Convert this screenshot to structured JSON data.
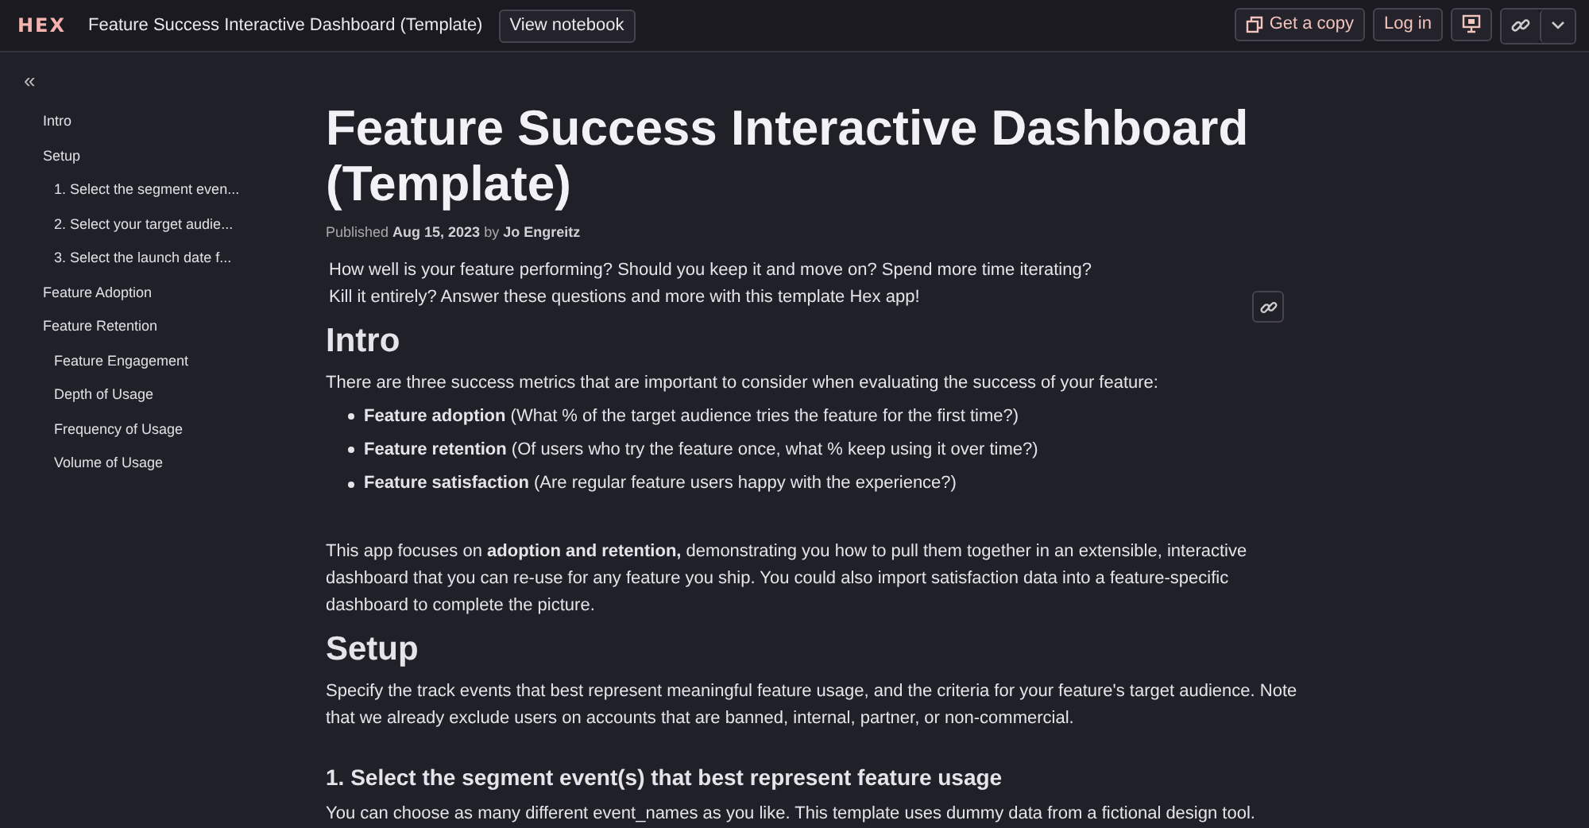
{
  "topbar": {
    "logo": "HEX",
    "title": "Feature Success Interactive Dashboard (Template)",
    "view_button": "View notebook",
    "copy_button": "Get a copy",
    "login_button": "Log in"
  },
  "sidebar": {
    "collapse": "«",
    "items": [
      {
        "label": "Intro"
      },
      {
        "label": "Setup",
        "children": [
          {
            "label": "1. Select the segment even..."
          },
          {
            "label": "2. Select your target audie..."
          },
          {
            "label": "3. Select the launch date f..."
          }
        ]
      },
      {
        "label": "Feature Adoption"
      },
      {
        "label": "Feature Retention",
        "children": [
          {
            "label": "Feature Engagement"
          },
          {
            "label": "Depth of Usage"
          },
          {
            "label": "Frequency of Usage"
          },
          {
            "label": "Volume of Usage"
          }
        ]
      }
    ]
  },
  "document": {
    "title": "Feature Success Interactive Dashboard (Template)",
    "byline": "Published **Aug 15, 2023** by **Jo Engreitz**",
    "intro": "How well is your feature performing? Should you keep it and move on? Spend more time iterating? Kill it entirely? Answer these questions and more with this template Hex app!",
    "blocks": [
      {
        "kind": "h1",
        "text": "Intro"
      },
      {
        "kind": "p",
        "text": "There are three success metrics that are important to consider when evaluating the success of your feature:"
      },
      {
        "kind": "list",
        "items": [
          "**Feature adoption** (What % of the target audience tries the feature for the first time?)",
          "**Feature retention** (Of users who try the feature once, what % keep using it over time?)",
          "**Feature satisfaction** (Are regular feature users happy with the experience?)"
        ]
      },
      {
        "kind": "p",
        "text": "This app focuses on **adoption and retention,** demonstrating you how to pull them together in an extensible, interactive dashboard that you can re-use for any feature you ship. You could also import satisfaction data into a feature-specific dashboard to complete the picture."
      },
      {
        "kind": "h1",
        "text": "Setup"
      },
      {
        "kind": "p",
        "text": "Specify the track events that best represent meaningful feature usage, and the criteria for your feature's target audience. Note that we already exclude users on accounts that are banned, internal, partner, or non-commercial."
      },
      {
        "kind": "h2",
        "text": "1. Select the segment event(s) that best represent feature usage"
      },
      {
        "kind": "p",
        "text": "You can choose as many different event_names as you like. This template uses dummy data from a fictional design tool."
      }
    ]
  }
}
